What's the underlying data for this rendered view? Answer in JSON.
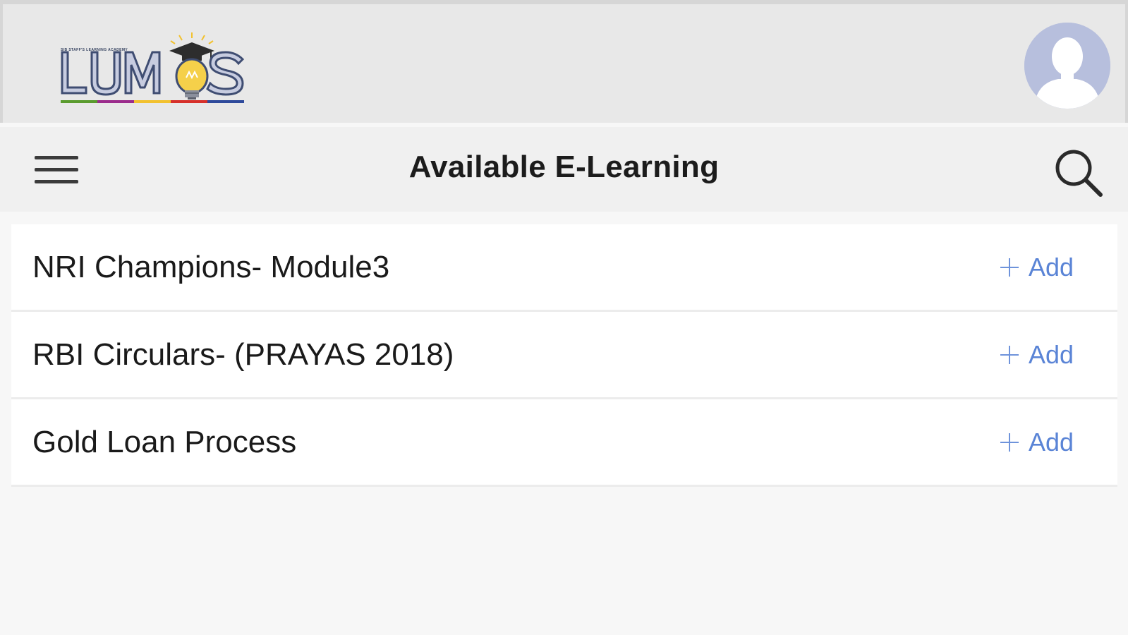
{
  "brand": {
    "logo_text": "LUMOS",
    "logo_tagline": "SIB STAFF'S LEARNING ACADEMY",
    "logo_stripe_colors": [
      "#5a9b2e",
      "#9b2c8c",
      "#f2c12e",
      "#d6302a",
      "#2e4a9b"
    ],
    "logo_color": "#33405e"
  },
  "header": {
    "title": "Available E-Learning"
  },
  "courses": [
    {
      "title": "NRI Champions- Module3",
      "action": "Add"
    },
    {
      "title": "RBI Circulars- (PRAYAS 2018)",
      "action": "Add"
    },
    {
      "title": "Gold Loan Process",
      "action": "Add"
    }
  ],
  "icons": {
    "menu": "hamburger-menu-icon",
    "search": "search-icon",
    "avatar": "user-avatar-icon",
    "add": "plus-icon"
  },
  "colors": {
    "accent": "#5a84d6",
    "brand_bar": "#e8e8e8",
    "nav_bar": "#f0f0f0",
    "background": "#f7f7f7"
  }
}
